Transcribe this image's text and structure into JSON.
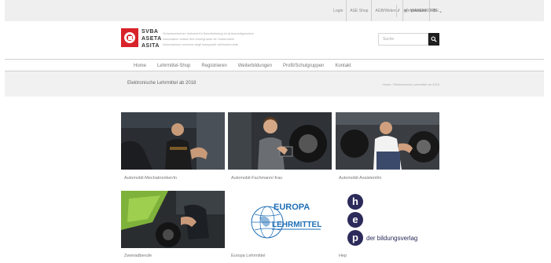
{
  "topbar": {
    "links": [
      "Login",
      "ASE Shop",
      "AGB/Widerruf",
      "Impressum",
      "DE"
    ],
    "cart_label": "WARENKORB"
  },
  "header": {
    "logo_lines": [
      "SVBA",
      "ASETA",
      "ASITA"
    ],
    "org_lines": [
      "Schweizerischer Verband für Berufsbildung im Automobilgewerbe",
      "Association suisse des enseignants de l'automobile",
      "Associazione svizzera degli insegnanti dell'automobile"
    ],
    "search_placeholder": "Suche"
  },
  "nav": {
    "items": [
      "Home",
      "Lehrmittel-Shop",
      "Registrieren",
      "Weiterbildungen",
      "Profil/Schulgruppen",
      "Kontakt"
    ]
  },
  "page": {
    "title": "Elektronische Lehrmittel ab 2018",
    "breadcrumb": "Home / Elektronische Lehrmittel ab 2018"
  },
  "cards": [
    {
      "label": "Automobil-Mechatroniker/in"
    },
    {
      "label": "Automobil-Fachmann/-frau"
    },
    {
      "label": "Automobil-Assistent/in"
    },
    {
      "label": "Zweiradberufe"
    },
    {
      "label": "Europa Lehrmittel"
    },
    {
      "label": "Hep"
    }
  ],
  "brands": {
    "europa_top": "EUROPA",
    "europa_bottom": "LEHRMITTEL",
    "hep_letters": [
      "h",
      "e",
      "p"
    ],
    "hep_tagline": "der bildungsverlag"
  },
  "colors": {
    "logo_red": "#d8232a",
    "hep_navy": "#2b2a5a",
    "europa_blue": "#1f6fb6"
  }
}
